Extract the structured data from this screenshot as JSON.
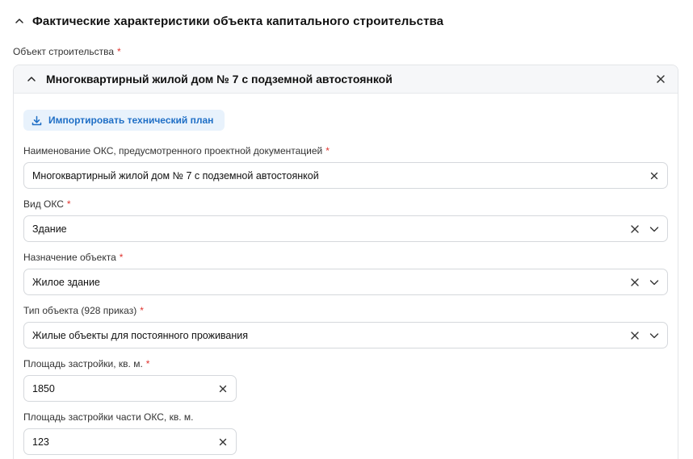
{
  "section": {
    "title": "Фактические характеристики объекта капитального строительства"
  },
  "object_field": {
    "label": "Объект строительства",
    "required_mark": "*"
  },
  "card": {
    "title": "Многоквартирный жилой дом № 7 с подземной автостоянкой",
    "import_button": "Импортировать технический план"
  },
  "fields": [
    {
      "label": "Наименование ОКС, предусмотренного проектной документацией",
      "required_mark": "*",
      "value": "Многоквартирный жилой дом № 7 с подземной автостоянкой",
      "type": "text"
    },
    {
      "label": "Вид ОКС",
      "required_mark": "*",
      "value": "Здание",
      "type": "select"
    },
    {
      "label": "Назначение объекта",
      "required_mark": "*",
      "value": "Жилое здание",
      "type": "select"
    },
    {
      "label": "Тип объекта (928 приказ)",
      "required_mark": "*",
      "value": "Жилые объекты для постоянного проживания",
      "type": "select"
    },
    {
      "label": "Площадь застройки, кв. м.",
      "required_mark": "*",
      "value": "1850",
      "type": "text"
    },
    {
      "label": "Площадь застройки части ОКС, кв. м.",
      "required_mark": "",
      "value": "123",
      "type": "text"
    }
  ],
  "icons": {
    "collapse": "chevron-up-icon",
    "close": "close-icon",
    "clear": "clear-icon",
    "dropdown": "chevron-down-icon",
    "download": "download-icon"
  },
  "colors": {
    "accent": "#1f6fc6",
    "accent_bg": "#e8f2fc",
    "required": "#e0342f",
    "border": "#d5d8dc"
  }
}
